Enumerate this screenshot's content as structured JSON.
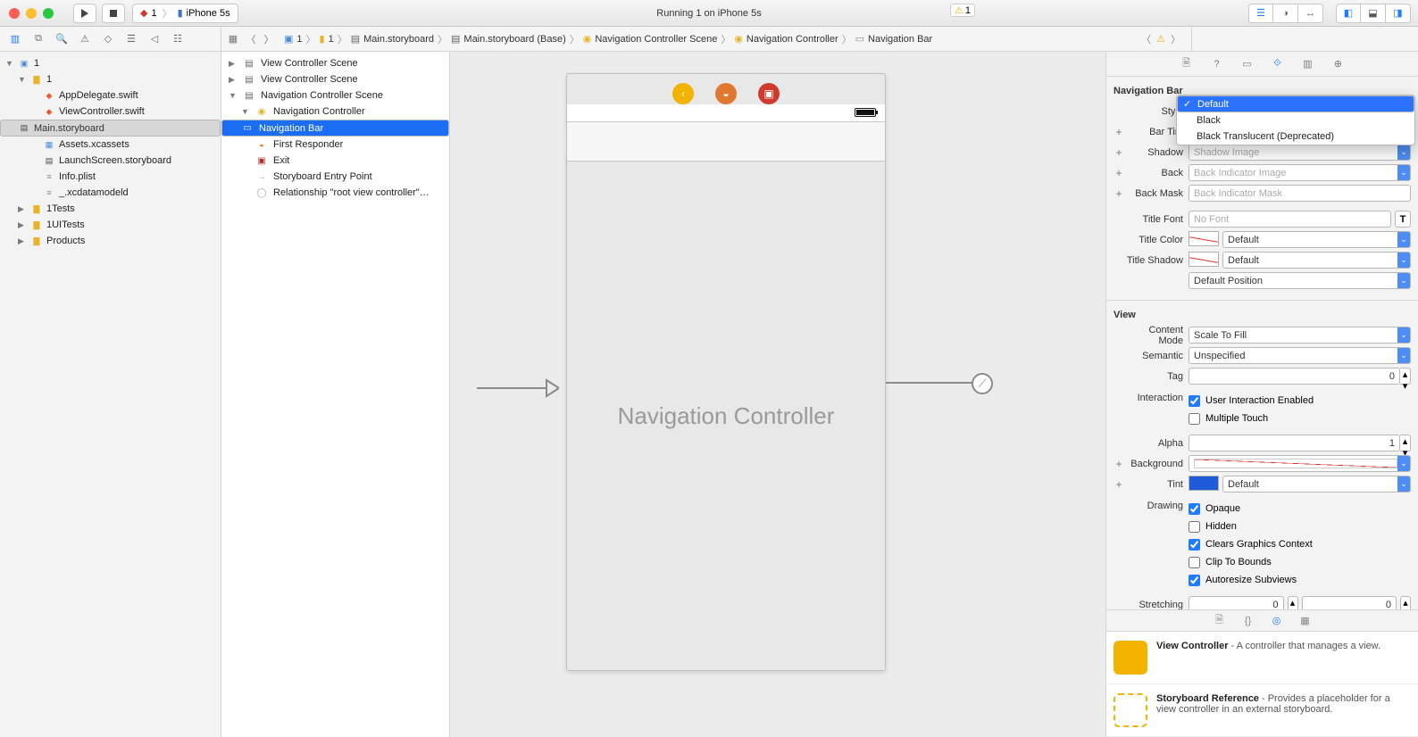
{
  "titlebar": {
    "scheme_app": "1",
    "scheme_dest": "iPhone 5s",
    "center_text": "Running 1 on iPhone 5s",
    "warning_count": "1"
  },
  "jumpbar": {
    "segs": [
      "1",
      "1",
      "Main.storyboard",
      "Main.storyboard (Base)",
      "Navigation Controller Scene",
      "Navigation Controller",
      "Navigation Bar"
    ],
    "warning_count": "1"
  },
  "navigator": {
    "items": [
      {
        "indent": 0,
        "disclosure": "▼",
        "icon": "proj",
        "label": "1"
      },
      {
        "indent": 1,
        "disclosure": "▼",
        "icon": "folder",
        "label": "1"
      },
      {
        "indent": 2,
        "disclosure": "",
        "icon": "swift",
        "label": "AppDelegate.swift"
      },
      {
        "indent": 2,
        "disclosure": "",
        "icon": "swift",
        "label": "ViewController.swift"
      },
      {
        "indent": 2,
        "disclosure": "",
        "icon": "sb",
        "label": "Main.storyboard",
        "selected": true
      },
      {
        "indent": 2,
        "disclosure": "",
        "icon": "assets",
        "label": "Assets.xcassets"
      },
      {
        "indent": 2,
        "disclosure": "",
        "icon": "sb",
        "label": "LaunchScreen.storyboard"
      },
      {
        "indent": 2,
        "disclosure": "",
        "icon": "plist",
        "label": "Info.plist"
      },
      {
        "indent": 2,
        "disclosure": "",
        "icon": "plist",
        "label": "_.xcdatamodeld"
      },
      {
        "indent": 1,
        "disclosure": "▶",
        "icon": "folder",
        "label": "1Tests"
      },
      {
        "indent": 1,
        "disclosure": "▶",
        "icon": "folder",
        "label": "1UITests"
      },
      {
        "indent": 1,
        "disclosure": "▶",
        "icon": "folder",
        "label": "Products"
      }
    ]
  },
  "outline": {
    "items": [
      {
        "pad": 0,
        "disclosure": "▶",
        "icon": "scene",
        "label": "View Controller Scene"
      },
      {
        "pad": 0,
        "disclosure": "▶",
        "icon": "scene",
        "label": "View Controller Scene"
      },
      {
        "pad": 0,
        "disclosure": "▼",
        "icon": "scene",
        "label": "Navigation Controller Scene"
      },
      {
        "pad": 1,
        "disclosure": "▼",
        "icon": "vc",
        "label": "Navigation Controller"
      },
      {
        "pad": 2,
        "disclosure": "",
        "icon": "nav",
        "label": "Navigation Bar",
        "selected": true
      },
      {
        "pad": 1,
        "disclosure": "",
        "icon": "fr",
        "label": "First Responder"
      },
      {
        "pad": 1,
        "disclosure": "",
        "icon": "exit",
        "label": "Exit"
      },
      {
        "pad": 1,
        "disclosure": "",
        "icon": "entry",
        "label": "Storyboard Entry Point"
      },
      {
        "pad": 1,
        "disclosure": "",
        "icon": "rel",
        "label": "Relationship \"root view controller\"…"
      }
    ]
  },
  "canvas": {
    "phone_label": "Navigation Controller"
  },
  "inspector": {
    "section1": "Navigation Bar",
    "style_label": "Style",
    "style_options": [
      "Default",
      "Black",
      "Black Translucent (Deprecated)"
    ],
    "bar_tint_label": "Bar Tint",
    "shadow_label": "Shadow",
    "shadow_placeholder": "Shadow Image",
    "back_label": "Back",
    "back_placeholder": "Back Indicator Image",
    "back_mask_label": "Back Mask",
    "back_mask_placeholder": "Back Indicator Mask",
    "title_font_label": "Title Font",
    "title_font_placeholder": "No Font",
    "title_color_label": "Title Color",
    "title_shadow_label": "Title Shadow",
    "default_text": "Default",
    "default_position_text": "Default Position",
    "section2": "View",
    "content_mode_label": "Content Mode",
    "content_mode_value": "Scale To Fill",
    "semantic_label": "Semantic",
    "semantic_value": "Unspecified",
    "tag_label": "Tag",
    "tag_value": "0",
    "interaction_label": "Interaction",
    "interaction_cb1": "User Interaction Enabled",
    "interaction_cb2": "Multiple Touch",
    "alpha_label": "Alpha",
    "alpha_value": "1",
    "background_label": "Background",
    "tint_label": "Tint",
    "drawing_label": "Drawing",
    "drawing_items": [
      "Opaque",
      "Hidden",
      "Clears Graphics Context",
      "Clip To Bounds",
      "Autoresize Subviews"
    ],
    "drawing_checked": [
      true,
      false,
      true,
      false,
      true
    ],
    "stretching_label": "Stretching",
    "stretching_v1": "0",
    "stretching_v2": "0"
  },
  "library": {
    "items": [
      {
        "solid": true,
        "title": "View Controller",
        "desc": " - A controller that manages a view."
      },
      {
        "solid": false,
        "title": "Storyboard Reference",
        "desc": " - Provides a placeholder for a view controller in an external storyboard."
      }
    ]
  }
}
